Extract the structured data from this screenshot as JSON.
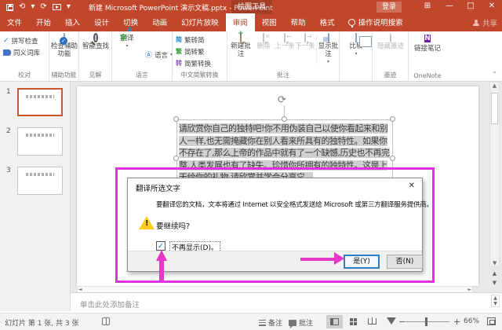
{
  "colors": {
    "brand": "#c0472b",
    "magenta_rect": "#df31df",
    "magenta_arrow": "#e637c8",
    "selected_thumb_border": "#d35230",
    "default_button_border": "#2e7fc2"
  },
  "title_bar": {
    "title": "新建 Microsoft PowerPoint 演示文稿.pptx - PowerPoint",
    "context_tool_group": "绘图工具",
    "sign_in": "登录"
  },
  "tabs": [
    "文件",
    "开始",
    "插入",
    "设计",
    "切换",
    "动画",
    "幻灯片放映",
    "审阅",
    "视图",
    "帮助",
    "格式"
  ],
  "active_tab": "审阅",
  "tell_me": "操作说明搜索",
  "share": "共享",
  "ribbon": {
    "proofing": {
      "label": "校对",
      "spelling": "拼写检查",
      "thesaurus": "同义词库"
    },
    "accessibility": {
      "label": "辅助功能",
      "check": "检查辅助功能"
    },
    "insights": {
      "label": "见解",
      "smart_lookup": "智能查找"
    },
    "language": {
      "label": "语言",
      "translate": "翻译",
      "language_btn": "语言"
    },
    "chinese_conversion": {
      "label": "中文简繁转换",
      "t2s": "繁转简",
      "s2t": "简转繁",
      "convert": "简繁转换"
    },
    "comments": {
      "label": "批注",
      "new": "新建批注",
      "delete": "删除",
      "previous": "上一条",
      "next": "下一条",
      "show": "显示批注"
    },
    "compare": {
      "compare": "比较"
    },
    "ink": {
      "label": "墨迹",
      "hide_ink": "隐藏墨迹"
    },
    "onenote": {
      "label": "OneNote",
      "linked_notes": "链接笔记"
    }
  },
  "slides_panel": {
    "numbers": [
      "1",
      "2",
      "3"
    ],
    "selected": "1"
  },
  "slide": {
    "text_lines": [
      "请欣赏你自己的独特吧!你不用伪装自己以使你看起来和别",
      "人一样,也无需掩藏你在别人看来所具有的独特性。如果你",
      "不存在了,那么上帝的作品中就有了一个缺憾,历史也不再完",
      "整,人类发展也有了缺失。珍惜你所拥有的独特性。这是上",
      "天给你的礼物,请欣赏并学会分享它。"
    ],
    "full_text": "请欣赏你自己的独特吧!你不用伪装自己以使你看起来和别人一样,也无需掩藏你在别人看来所具有的独特性。如果你不存在了,那么上帝的作品中就有了一个缺憾,历史也不再完整,人类发展也有了缺失。珍惜你所拥有的独特性。这是上天给你的礼物,请欣赏并学会分享它。"
  },
  "dialog": {
    "title": "翻译所选文字",
    "body": "要翻译您的文档，文本将通过 Internet 以安全格式发送给 Microsoft 或第三方翻译服务提供商。",
    "question": "要继续吗?",
    "checkbox_label": "不再显示(D)。",
    "checkbox_checked": "✓",
    "yes_button": "是(Y)",
    "no_button": "否(N)",
    "close": "✕"
  },
  "notes": {
    "placeholder": "单击此处添加备注"
  },
  "status_bar": {
    "slide_indicator": "幻灯片 第 1 张, 共 3 张",
    "notes_toggle": "备注",
    "comments_toggle": "批注",
    "zoom_level": "66%",
    "zoom_out": "−",
    "zoom_in": "+"
  },
  "glyphs": {
    "undo": "⟲",
    "redo": "⟳",
    "caret": "▾",
    "ribbon_options": "⊞",
    "minimize": "—",
    "maximize": "□",
    "close": "✕",
    "collapse": "⌃",
    "up": "▲",
    "down": "▼",
    "left": "◄",
    "right": "►",
    "rotate": "⟳"
  }
}
